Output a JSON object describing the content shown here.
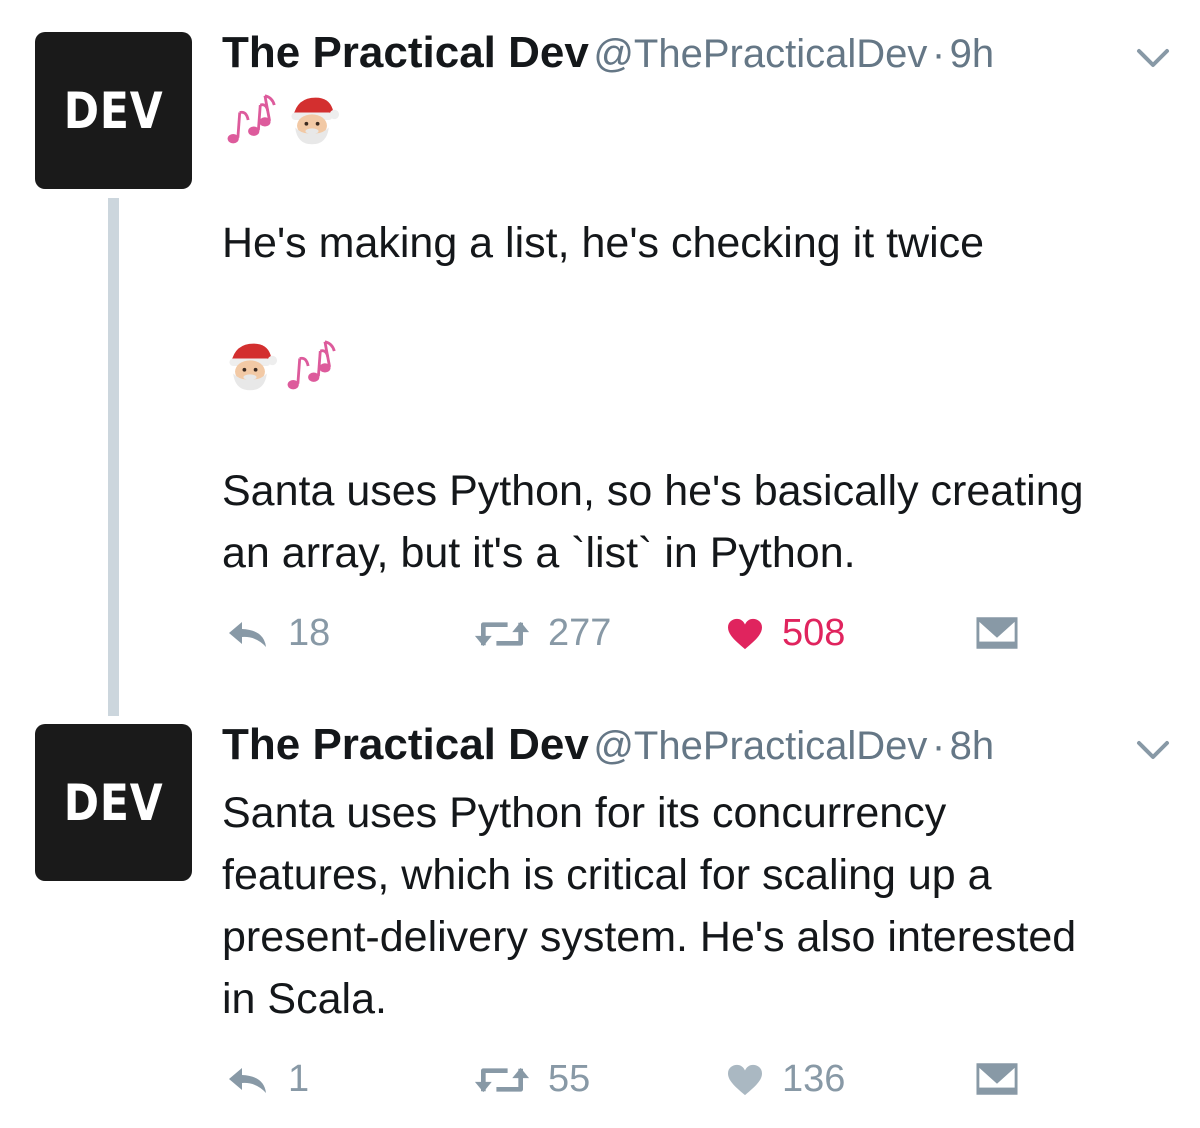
{
  "tweets": [
    {
      "avatar_text": "DEV",
      "display_name": "The Practical Dev",
      "handle": "@ThePracticalDev",
      "separator": "·",
      "time": "9h",
      "body_lines": [
        "He's making a list, he's checking it twice",
        "Santa uses Python, so he's basically creating",
        "an array, but it's a `list` in Python."
      ],
      "actions": {
        "reply_count": "18",
        "retweet_count": "277",
        "like_count": "508",
        "liked": true
      }
    },
    {
      "avatar_text": "DEV",
      "display_name": "The Practical Dev",
      "handle": "@ThePracticalDev",
      "separator": "·",
      "time": "8h",
      "body_lines": [
        "Santa uses Python for its concurrency",
        "features, which is critical for scaling up a",
        "present-delivery system. He's also interested",
        "in Scala."
      ],
      "actions": {
        "reply_count": "1",
        "retweet_count": "55",
        "like_count": "136",
        "liked": false
      }
    }
  ],
  "icons": {
    "emoji_sequence_1": [
      "musical-notes-icon",
      "santa-icon"
    ],
    "emoji_sequence_2": [
      "santa-icon",
      "musical-notes-icon"
    ],
    "reply": "reply-icon",
    "retweet": "retweet-icon",
    "like": "heart-icon",
    "dm": "envelope-icon",
    "menu": "chevron-down-icon"
  },
  "colors": {
    "text": "#14171a",
    "secondary": "#657786",
    "action_gray": "#8899a6",
    "like_red": "#e0245e",
    "thread_line": "#ccd6dd",
    "avatar_bg": "#1a1a1a",
    "note_pink": "#dd5b9c",
    "santa_red": "#d32f2f"
  }
}
